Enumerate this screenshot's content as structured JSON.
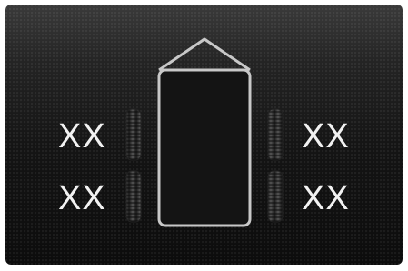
{
  "tire_pressure": {
    "front_left": "XX",
    "front_right": "XX",
    "rear_left": "XX",
    "rear_right": "XX"
  },
  "icons": {
    "vehicle": "car-top-view-icon",
    "tire": "tire-icon"
  },
  "colors": {
    "background": "#141414",
    "vehicle_outline": "#c8c8c8",
    "text": "#f2f2f2"
  }
}
